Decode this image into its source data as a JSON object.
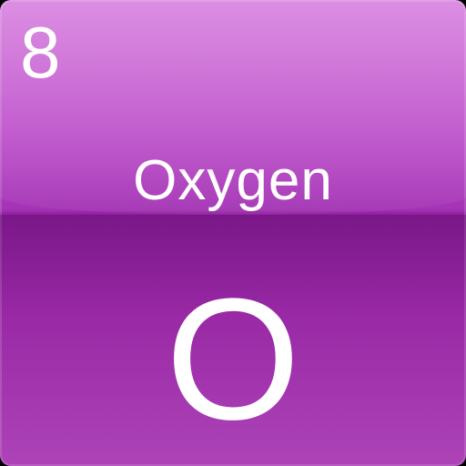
{
  "element": {
    "atomic_number": "8",
    "name": "Oxygen",
    "symbol": "O"
  },
  "colors": {
    "tile_top": "#ce63d8",
    "tile_bottom": "#9a2aa6",
    "text": "#ffffff"
  }
}
